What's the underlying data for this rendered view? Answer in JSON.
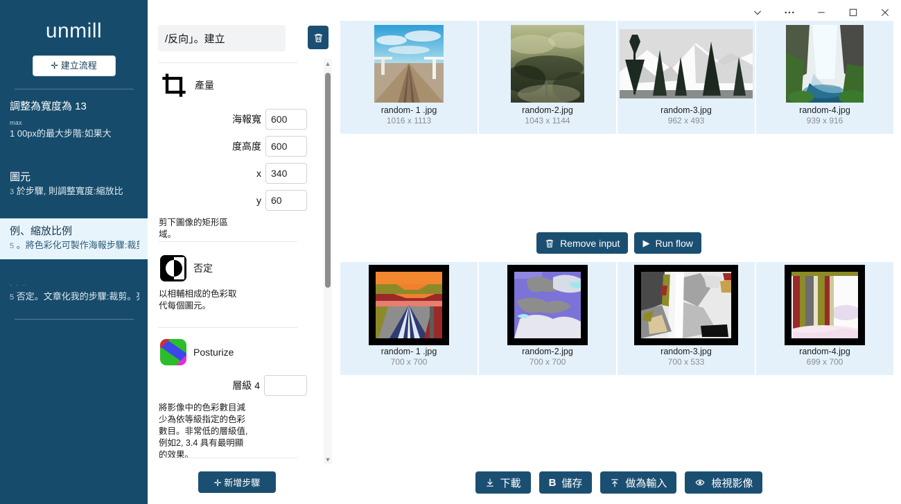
{
  "sidebar": {
    "brand": "unmill",
    "new_flow_button": "建立流程",
    "new_flow_icon": "plus-icon",
    "items": [
      {
        "title": "調整為寬度為 13",
        "max_label": "max",
        "subtitle": "1 00px的最大步階:如果大",
        "active": false
      },
      {
        "title": "圖元",
        "lead": "3",
        "subtitle": "於步驟, 則調整寬度:縮放比",
        "active": false
      },
      {
        "title": "例、縮放比例",
        "lead": "5",
        "subtitle": "。將色彩化可製作海報步驟:裁剪",
        "active": true
      },
      {
        "title": "",
        "lead": "5",
        "subtitle": "否定。文章化我的步驟:裁剪。亮度",
        "active": false
      }
    ]
  },
  "flow_panel": {
    "flow_name_value": "/反向」。建立",
    "delete_icon": "trash-icon",
    "add_step_button": "新增步驟",
    "add_step_icon": "plus-icon",
    "steps": [
      {
        "icon": "crop-icon",
        "title": "產量",
        "fields": [
          {
            "label": "海報寬",
            "value": "600"
          },
          {
            "label": "度高度",
            "value": "600"
          },
          {
            "label": "x",
            "value": "340"
          },
          {
            "label": "y",
            "value": "60"
          }
        ],
        "description": "剪下圖像的矩形區域。"
      },
      {
        "icon": "negate-icon",
        "title": "否定",
        "fields": [],
        "description": "以相輔相成的色彩取代每個圖元。"
      },
      {
        "icon": "posterize-icon",
        "title": "Posturize",
        "fields": [
          {
            "label": "層級 4",
            "value": ""
          }
        ],
        "description": "將影像中的色彩數目減少為依等級指定的色彩數目。非常低的層級值, 例如2, 3.4 具有最明顯的效果。"
      }
    ]
  },
  "titlebar": {
    "buttons": [
      {
        "name": "chevron-down-icon",
        "glyph": "⌄"
      },
      {
        "name": "more-options-icon",
        "glyph": "···"
      },
      {
        "name": "minimize-icon",
        "glyph": "—"
      },
      {
        "name": "maximize-icon",
        "glyph": "▢"
      },
      {
        "name": "close-icon",
        "glyph": "✕"
      }
    ]
  },
  "input_images": [
    {
      "name": "random- 1 .jpg",
      "dimensions": "1016 x 1113"
    },
    {
      "name": "random-2.jpg",
      "dimensions": "1043 x 1144"
    },
    {
      "name": "random-3.jpg",
      "dimensions": "962 x 493"
    },
    {
      "name": "random-4.jpg",
      "dimensions": "939 x 916"
    }
  ],
  "output_images": [
    {
      "name": "random- 1 .jpg",
      "dimensions": "700 x 700"
    },
    {
      "name": "random-2.jpg",
      "dimensions": "700 x 700"
    },
    {
      "name": "random-3.jpg",
      "dimensions": "700 x 533"
    },
    {
      "name": "random-4.jpg",
      "dimensions": "699 x 700"
    }
  ],
  "middle_actions": [
    {
      "label": "Remove input",
      "icon": "trash-icon"
    },
    {
      "label": "Run flow",
      "icon": "play-icon"
    }
  ],
  "bottom_actions": [
    {
      "label": "下載",
      "icon": "download-icon"
    },
    {
      "label": "儲存",
      "icon": "b-icon"
    },
    {
      "label": "做為輸入",
      "icon": "upload-icon"
    },
    {
      "label": "檢視影像",
      "icon": "eye-icon"
    }
  ],
  "colors": {
    "sidebar_bg": "#174B6B",
    "accent": "#1b4f72",
    "cell_bg": "#e4f1fb",
    "active_item_bg": "#e8f4fb"
  }
}
